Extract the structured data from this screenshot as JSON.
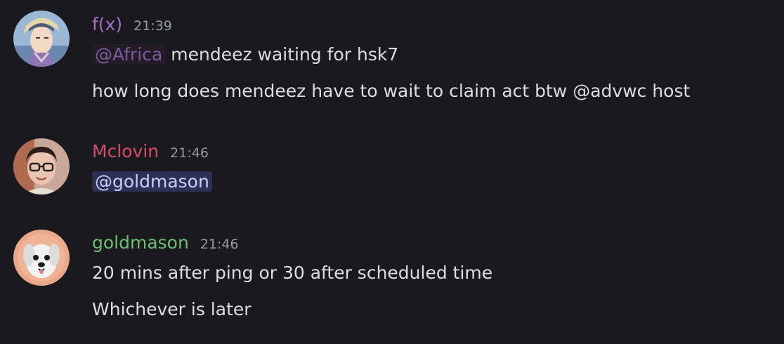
{
  "messages": [
    {
      "author": "f(x)",
      "author_color": "#a46fc8",
      "time": "21:39",
      "avatar_icon": "anime-character-avatar",
      "lines": [
        {
          "mention": "@Africa",
          "text": "mendeez waiting for hsk7"
        },
        {
          "text": "how long does mendeez have to wait to claim act btw @advwc host"
        }
      ]
    },
    {
      "author": "Mclovin",
      "author_color": "#d34b6f",
      "time": "21:46",
      "avatar_icon": "person-with-glasses-avatar",
      "lines": [
        {
          "mention": "@goldmason"
        }
      ]
    },
    {
      "author": "goldmason",
      "author_color": "#6dbd74",
      "time": "21:46",
      "avatar_icon": "white-dog-avatar",
      "lines": [
        {
          "text": "20 mins after ping or 30 after scheduled time"
        },
        {
          "text": "Whichever is later"
        }
      ]
    }
  ],
  "colors": {
    "background": "#1a1a1e",
    "text": "#dbdee1",
    "timestamp": "#949ba4",
    "role_mention_bg": "#241c24",
    "role_mention_text": "#7d5aa0",
    "user_mention_bg": "#2d3055",
    "user_mention_text": "#c9cdfb"
  }
}
